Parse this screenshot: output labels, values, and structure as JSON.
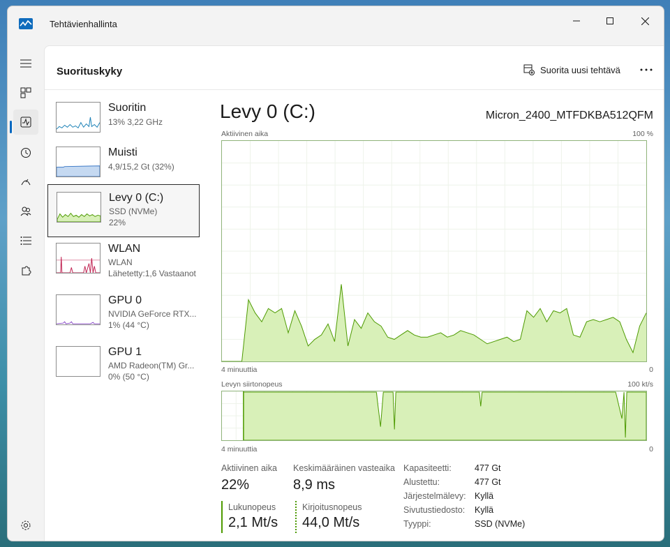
{
  "app": {
    "title": "Tehtävienhallinta"
  },
  "header": {
    "page_title": "Suorituskyky",
    "run_task_label": "Suorita uusi tehtävä"
  },
  "sidebar": [
    {
      "name": "Suoritin",
      "line1": "13%  3,22 GHz",
      "line2": ""
    },
    {
      "name": "Muisti",
      "line1": "4,9/15,2 Gt (32%)",
      "line2": ""
    },
    {
      "name": "Levy 0 (C:)",
      "line1": "SSD (NVMe)",
      "line2": "22%"
    },
    {
      "name": "WLAN",
      "line1": "WLAN",
      "line2": "Lähetetty:1,6 Vastaanot"
    },
    {
      "name": "GPU 0",
      "line1": "NVIDIA GeForce RTX...",
      "line2": "1% (44 °C)"
    },
    {
      "name": "GPU 1",
      "line1": "AMD Radeon(TM) Gr...",
      "line2": "0% (50 °C)"
    }
  ],
  "detail": {
    "title": "Levy 0 (C:)",
    "model": "Micron_2400_MTFDKBA512QFM",
    "graph1": {
      "label": "Aktiivinen aika",
      "max": "100 %",
      "time_left": "4 minuuttia",
      "time_right": "0",
      "values": [
        0,
        0,
        0,
        0,
        28,
        22,
        18,
        24,
        22,
        24,
        13,
        23,
        16,
        7,
        10,
        12,
        17,
        9,
        35,
        7,
        19,
        15,
        22,
        18,
        16,
        11,
        10,
        12,
        14,
        12,
        11,
        11,
        12,
        13,
        11,
        12,
        14,
        13,
        12,
        10,
        8,
        9,
        10,
        11,
        9,
        10,
        23,
        20,
        24,
        18,
        23,
        22,
        24,
        12,
        11,
        18,
        19,
        18,
        19,
        20,
        18,
        10,
        4,
        16,
        22
      ]
    },
    "graph2": {
      "label": "Levyn siirtonopeus",
      "max": "100 kt/s",
      "time_left": "4 minuuttia",
      "time_right": "0"
    },
    "stats": {
      "active_label": "Aktiivinen aika",
      "active_value": "22%",
      "resp_label": "Keskimääräinen vasteaika",
      "resp_value": "8,9 ms",
      "read_label": "Lukunopeus",
      "read_value": "2,1 Mt/s",
      "write_label": "Kirjoitusnopeus",
      "write_value": "44,0 Mt/s"
    },
    "props": [
      {
        "key": "Kapasiteetti:",
        "value": "477 Gt"
      },
      {
        "key": "Alustettu:",
        "value": "477 Gt"
      },
      {
        "key": "Järjestelmälevy:",
        "value": "Kyllä"
      },
      {
        "key": "Sivutustiedosto:",
        "value": "Kyllä"
      },
      {
        "key": "Tyyppi:",
        "value": "SSD (NVMe)"
      }
    ]
  },
  "colors": {
    "disk_fill": "#d8f0b8",
    "disk_line": "#4d9a00",
    "cpu_line": "#1a80b6",
    "mem_fill": "#c5d9f1",
    "wlan_line": "#c02050",
    "gpu_line": "#8a4ac8",
    "accent": "#0067c0"
  }
}
